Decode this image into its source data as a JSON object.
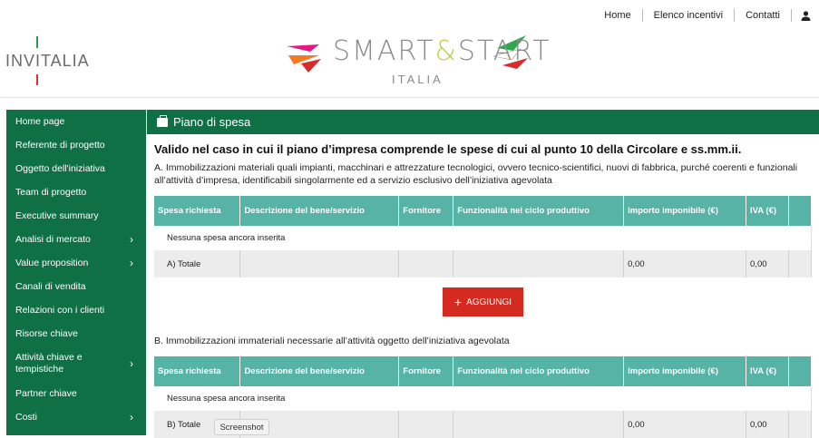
{
  "topnav": {
    "home": "Home",
    "incentivi": "Elenco incentivi",
    "contatti": "Contatti"
  },
  "logos": {
    "invitalia": "INVITALIA",
    "smart": "SMART",
    "amp": "&",
    "start": "START",
    "italia": "ITALIA"
  },
  "sidebar": {
    "items": [
      {
        "label": "Home page"
      },
      {
        "label": "Referente di progetto"
      },
      {
        "label": "Oggetto dell'iniziativa"
      },
      {
        "label": "Team di progetto"
      },
      {
        "label": "Executive summary"
      },
      {
        "label": "Analisi di mercato",
        "chevron": "›"
      },
      {
        "label": "Value proposition",
        "chevron": "›"
      },
      {
        "label": "Canali di vendita"
      },
      {
        "label": "Relazioni con i clienti"
      },
      {
        "label": "Risorse chiave"
      },
      {
        "label": "Attività chiave e tempistiche",
        "chevron": "›"
      },
      {
        "label": "Partner chiave"
      },
      {
        "label": "Costi",
        "chevron": "›"
      }
    ]
  },
  "panel": {
    "title": "Piano di spesa",
    "section_title": "Valido nel caso in cui il piano d’impresa comprende le spese di cui al punto 10 della Circolare e ss.mm.ii.",
    "para_a": "A. Immobilizzazioni materiali quali impianti, macchinari e attrezzature tecnologici, ovvero tecnico-scientifici, nuovi di fabbrica, purché coerenti e funzionali all’attività d’impresa, identificabili singolarmente ed a servizio esclusivo dell’iniziativa agevolata",
    "para_b": "B. Immobilizzazioni immateriali necessarie all’attività oggetto dell’iniziativa agevolata",
    "add_button": "AGGIUNGI",
    "add_plus": "+"
  },
  "table": {
    "headers": [
      "Spesa richiesta",
      "Descrizione del bene/servizio",
      "Fornitore",
      "Funzionalità nel ciclo produttivo",
      "Importo imponibile (€)",
      "IVA (€)"
    ],
    "empty_text": "Nessuna spesa ancora inserita",
    "total_a_label": "A) Totale",
    "total_b_label": "B) Totale",
    "total_imponibile": "0,00",
    "total_iva": "0,00"
  },
  "tooltip": "Screenshot",
  "colors": {
    "primary_green": "#0f6f45",
    "table_header": "#56b3a6",
    "button_red": "#d42a1f"
  }
}
